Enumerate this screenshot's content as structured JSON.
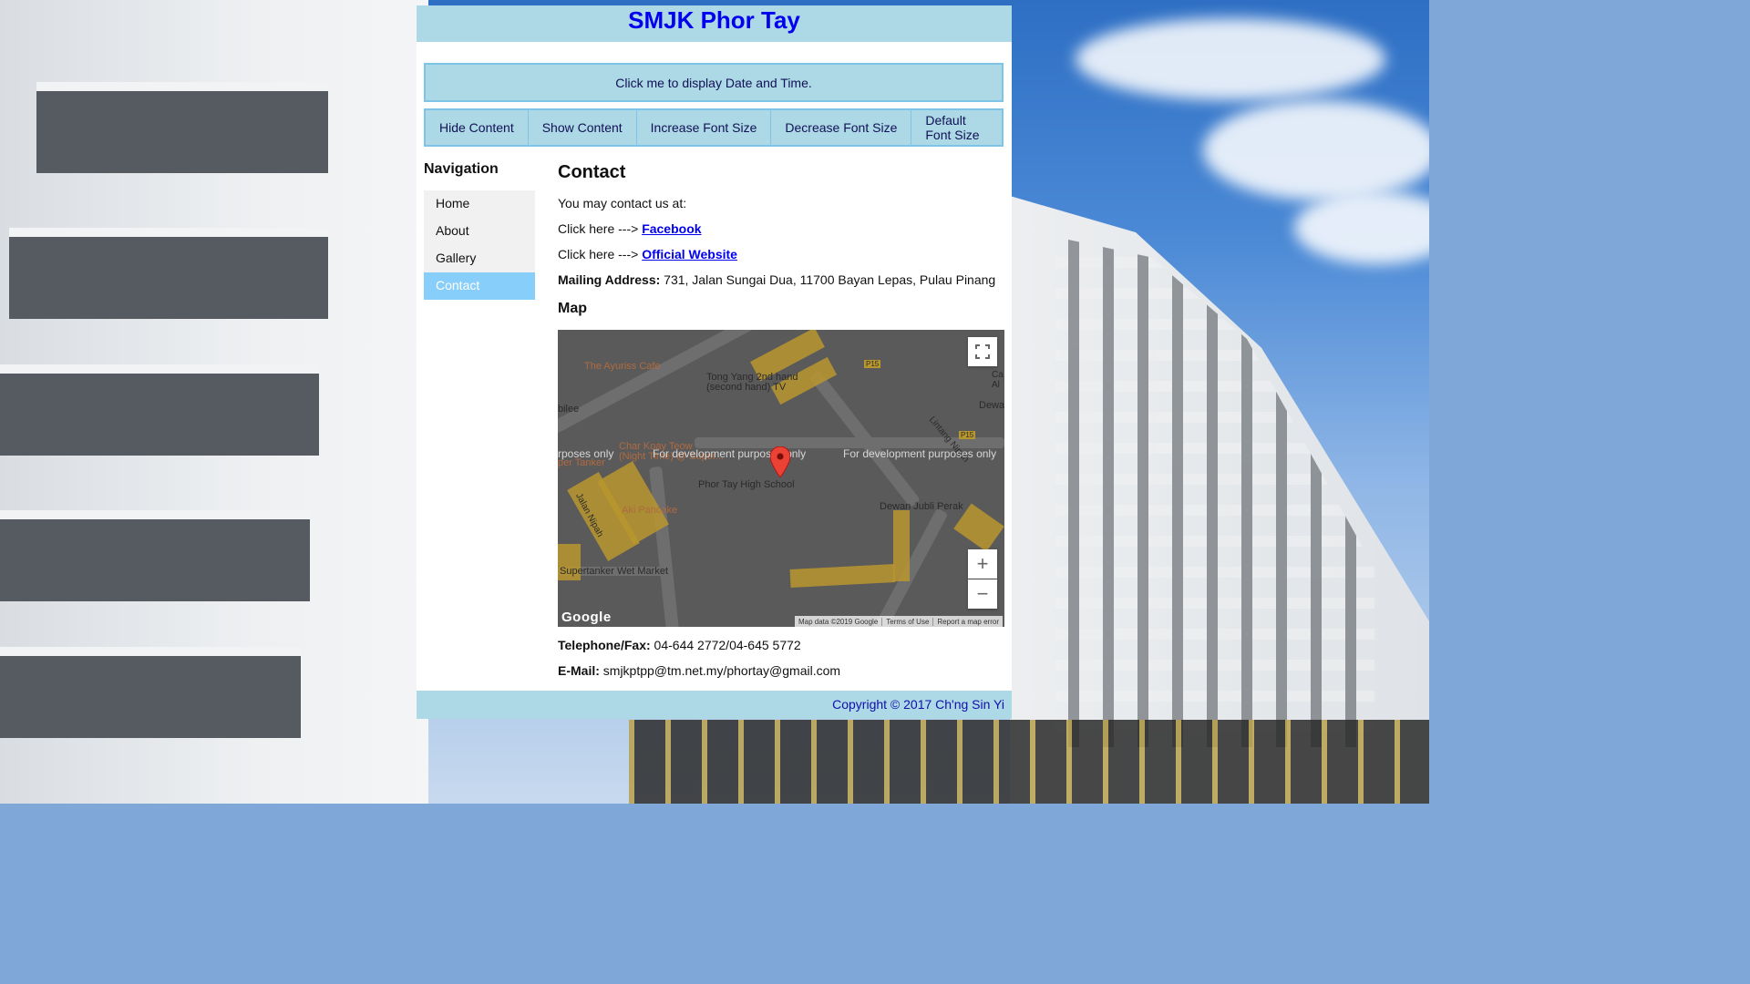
{
  "site": {
    "title": "SMJK Phor Tay"
  },
  "datetime": {
    "label": "Click me to display Date and Time."
  },
  "toolbar": {
    "hide": "Hide Content",
    "show": "Show Content",
    "increase": "Increase Font Size",
    "decrease": "Decrease Font Size",
    "default": "Default Font Size"
  },
  "nav": {
    "heading": "Navigation",
    "items": [
      "Home",
      "About",
      "Gallery",
      "Contact"
    ],
    "active": "Contact"
  },
  "contact": {
    "heading": "Contact",
    "intro": "You may contact us at:",
    "click_prefix": "Click here --->",
    "facebook": "Facebook",
    "website": "Official Website",
    "mailing_label": "Mailing Address:",
    "mailing_value": "731, Jalan Sungai Dua, 11700 Bayan Lepas, Pulau Pinang",
    "map_heading": "Map",
    "tel_label": "Telephone/Fax:",
    "tel_value": "04-644 2772/04-645 5772",
    "email_label": "E-Mail:",
    "email_value": "smjkptpp@tm.net.my/phortay@gmail.com"
  },
  "map": {
    "labels": {
      "cafe": "The Ayuriss Cafe",
      "tongyang": "Tong Yang 2nd hand\n(second hand) TV",
      "jubilee": "bilee",
      "charkoay": "Char Koay Teow\n(Night Time) @ Super...",
      "tanker": "per Tanker",
      "school": "Phor Tay High School",
      "pancake": "Aki Pancake",
      "dewan": "Dewan Jubli Perak",
      "market": "Supertanker Wet Market",
      "jalan_nipah": "Jalan Nipah",
      "lintang": "Lintang Nipah",
      "dewa": "Dewa",
      "ca": "Ca\nAl",
      "p15": "P15"
    },
    "dev_text": [
      "rposes only",
      "For development purposes only",
      "For development purposes only"
    ],
    "zoom_in": "+",
    "zoom_out": "−",
    "attribution": [
      "Map data ©2019 Google",
      "Terms of Use",
      "Report a map error"
    ],
    "google_logo": "Google"
  },
  "footer": {
    "copyright": "Copyright © 2017 Ch'ng Sin Yi"
  }
}
